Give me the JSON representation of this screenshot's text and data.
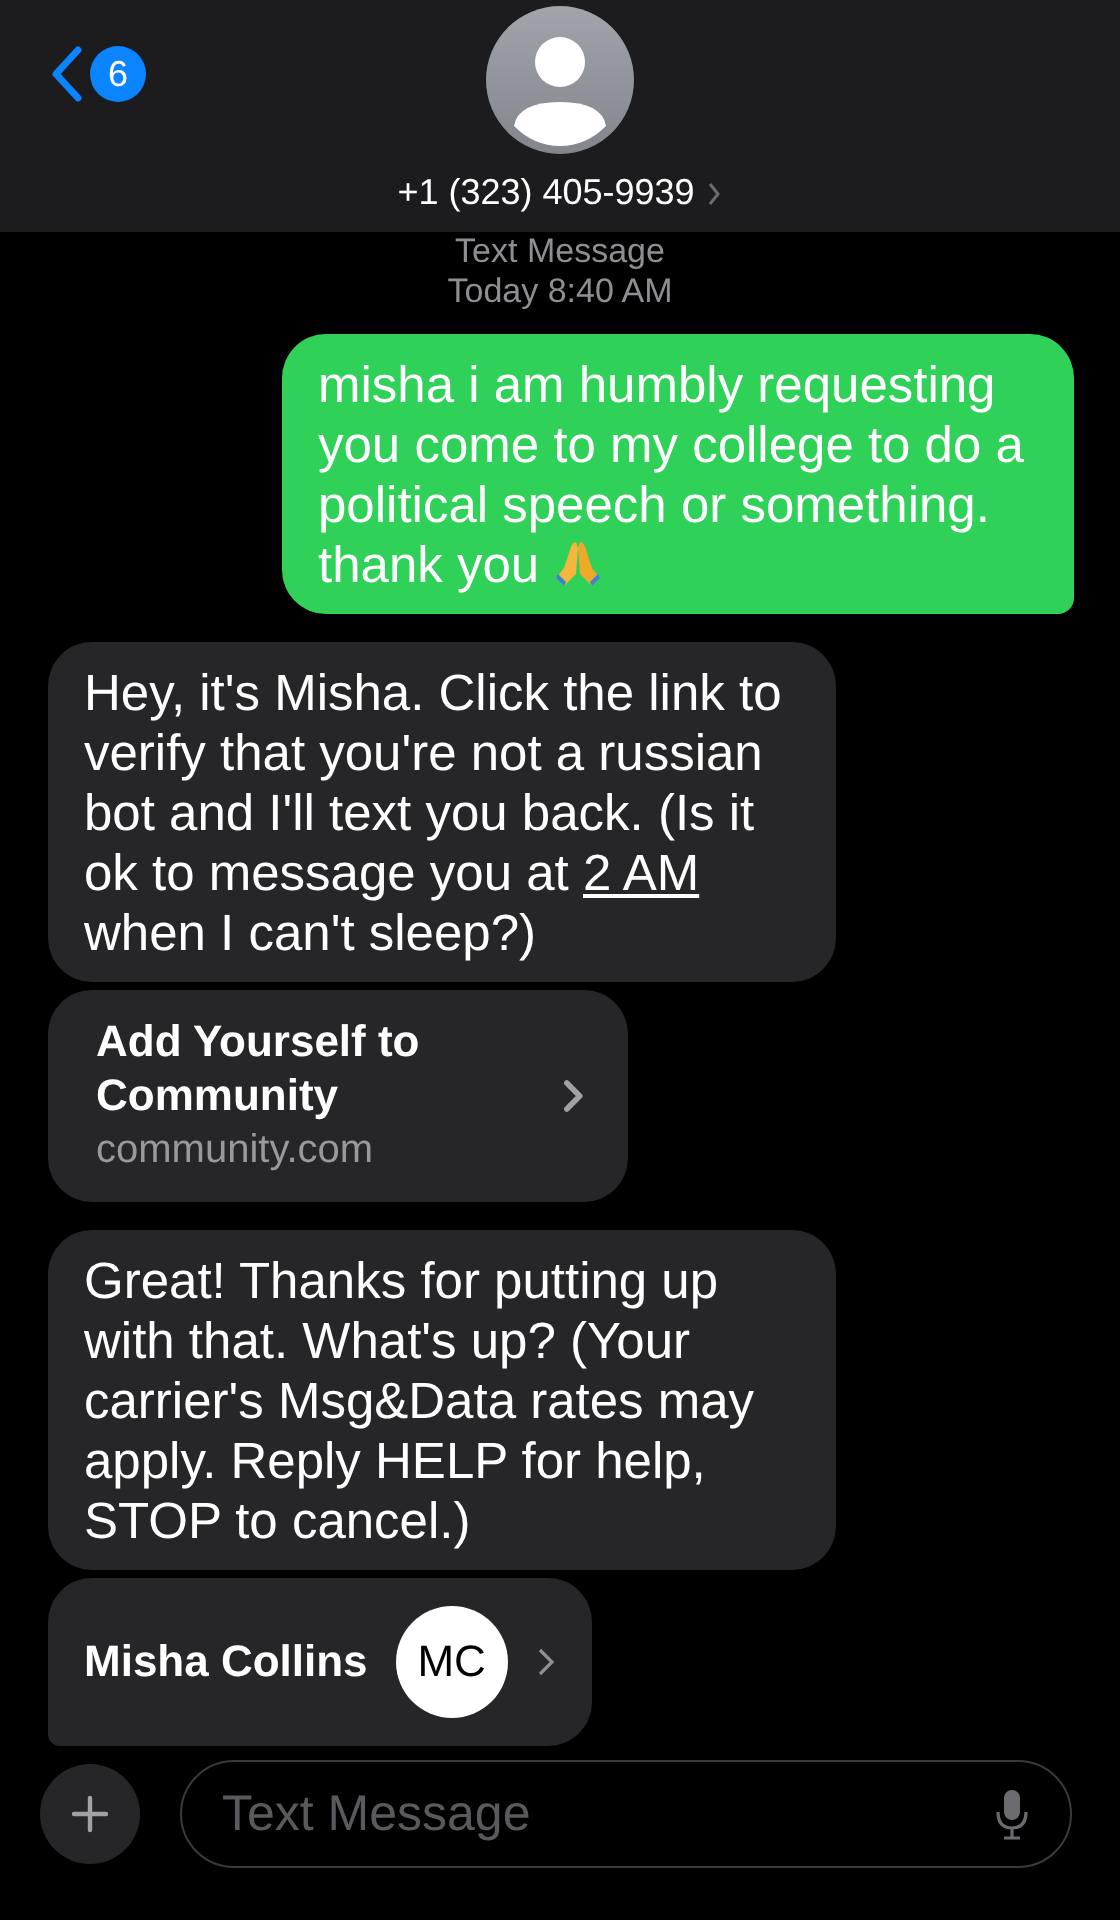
{
  "header": {
    "back_badge": "6",
    "contact": "+1 (323) 405-9939"
  },
  "thread": {
    "service": "Text Message",
    "timestamp": "Today 8:40 AM"
  },
  "messages": [
    {
      "kind": "sent",
      "parts": [
        {
          "text": "misha i am humbly requesting you come to my college to do a political speech or something. thank you",
          "link": false
        }
      ],
      "praying_hands": true
    },
    {
      "kind": "received",
      "parts": [
        {
          "text": "Hey, it's Misha. Click the link to verify that you're not a russian bot and I'll text you back. (Is it ok to message you at ",
          "link": false
        },
        {
          "text": "2 AM",
          "link": true
        },
        {
          "text": " when I can't sleep?)",
          "link": false
        }
      ]
    },
    {
      "kind": "link",
      "title": "Add Yourself to Community",
      "domain": "community.com"
    },
    {
      "kind": "received",
      "parts": [
        {
          "text": "Great! Thanks for putting up with that. What's up? (Your carrier's Msg&Data rates may apply. Reply HELP for help, STOP to cancel.)",
          "link": false
        }
      ]
    },
    {
      "kind": "contact",
      "name": "Misha Collins",
      "initials": "MC",
      "tail": true
    }
  ],
  "composer": {
    "placeholder": "Text Message"
  }
}
